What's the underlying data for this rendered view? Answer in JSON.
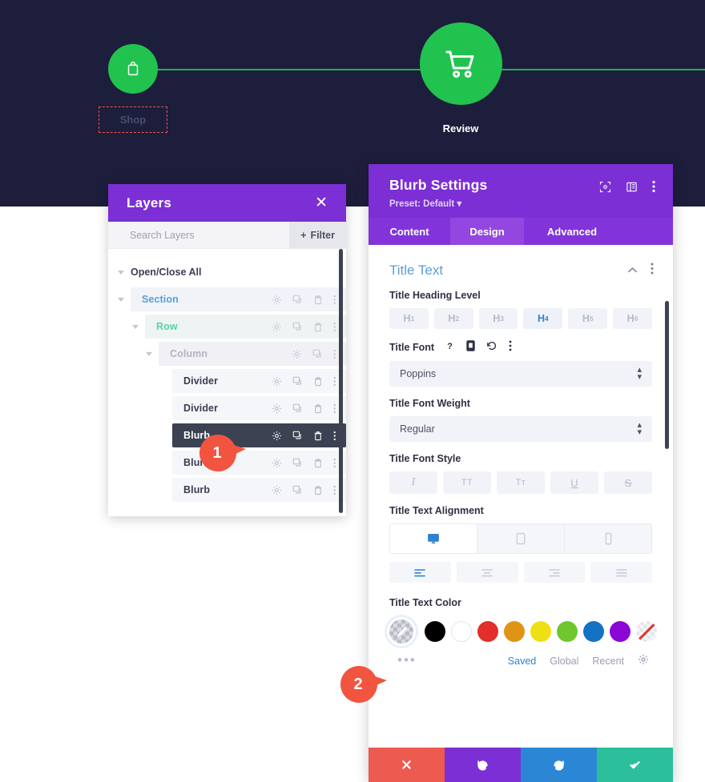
{
  "hero": {
    "steps": [
      {
        "name": "shop",
        "label": "Shop",
        "icon": "shopping-bag-icon"
      },
      {
        "name": "review",
        "label": "Review",
        "icon": "shopping-cart-icon"
      }
    ],
    "bg_color": "#1c1e3c",
    "accent_color": "#22c24f"
  },
  "layers": {
    "title": "Layers",
    "close_label": "✕",
    "search_placeholder": "Search Layers",
    "search_value": "",
    "filter_label": "Filter",
    "open_close_all": "Open/Close All",
    "rows": [
      {
        "label": "Section",
        "level": 1,
        "icons": [
          "gear-icon",
          "duplicate-icon",
          "trash-icon",
          "more-icon"
        ]
      },
      {
        "label": "Row",
        "level": 2,
        "icons": [
          "gear-icon",
          "duplicate-icon",
          "trash-icon",
          "more-icon"
        ]
      },
      {
        "label": "Column",
        "level": 3,
        "icons": [
          "gear-icon",
          "duplicate-icon",
          "more-icon"
        ]
      },
      {
        "label": "Divider",
        "level": 4,
        "icons": [
          "gear-icon",
          "duplicate-icon",
          "trash-icon",
          "more-icon"
        ]
      },
      {
        "label": "Divider",
        "level": 4,
        "icons": [
          "gear-icon",
          "duplicate-icon",
          "trash-icon",
          "more-icon"
        ]
      },
      {
        "label": "Blurb",
        "level": 4,
        "icons": [
          "gear-icon",
          "duplicate-icon",
          "trash-icon",
          "more-icon"
        ],
        "selected": true
      },
      {
        "label": "Blurb",
        "level": 4,
        "icons": [
          "gear-icon",
          "duplicate-icon",
          "trash-icon",
          "more-icon"
        ]
      },
      {
        "label": "Blurb",
        "level": 4,
        "icons": [
          "gear-icon",
          "duplicate-icon",
          "trash-icon",
          "more-icon"
        ]
      }
    ]
  },
  "markers": [
    {
      "number": "1"
    },
    {
      "number": "2"
    }
  ],
  "settings": {
    "title": "Blurb Settings",
    "preset": "Preset: Default ▾",
    "header_icons": [
      "fullscreen-icon",
      "layout-icon",
      "more-icon"
    ],
    "tabs": [
      {
        "label": "Content",
        "active": false
      },
      {
        "label": "Design",
        "active": true
      },
      {
        "label": "Advanced",
        "active": false
      }
    ],
    "section": {
      "title": "Title Text",
      "collapse_icon": "chevron-up-icon",
      "more_icon": "more-icon"
    },
    "heading_level": {
      "label": "Title Heading Level",
      "options": [
        "H1",
        "H2",
        "H3",
        "H4",
        "H5",
        "H6"
      ],
      "selected": "H4"
    },
    "font": {
      "label": "Title Font",
      "label_icons": [
        "help-icon",
        "responsive-icon",
        "reset-icon",
        "more-icon"
      ],
      "value": "Poppins"
    },
    "font_weight": {
      "label": "Title Font Weight",
      "value": "Regular"
    },
    "font_style": {
      "label": "Title Font Style",
      "options": [
        "I",
        "TT",
        "Tᴛ",
        "U",
        "S"
      ],
      "names": [
        "italic-icon",
        "uppercase-icon",
        "smallcaps-icon",
        "underline-icon",
        "strikethrough-icon"
      ]
    },
    "alignment": {
      "label": "Title Text Alignment",
      "devices": [
        {
          "name": "desktop-icon",
          "active": true
        },
        {
          "name": "tablet-icon",
          "active": false
        },
        {
          "name": "phone-icon",
          "active": false
        }
      ],
      "options": [
        {
          "name": "align-left-icon",
          "active": true
        },
        {
          "name": "align-center-icon",
          "active": false
        },
        {
          "name": "align-right-icon",
          "active": false
        },
        {
          "name": "align-justify-icon",
          "active": false
        }
      ]
    },
    "color": {
      "label": "Title Text Color",
      "eyedropper": "eyedropper-icon",
      "more_dots": "•••",
      "swatches": [
        "#000000",
        "#ffffff",
        "#e03029",
        "#e09416",
        "#efe014",
        "#6ec72d",
        "#1272c4",
        "#8b06d6",
        "none"
      ],
      "tabs": [
        {
          "label": "Saved",
          "active": true
        },
        {
          "label": "Global",
          "active": false
        },
        {
          "label": "Recent",
          "active": false
        }
      ],
      "gear_icon": "gear-icon"
    },
    "footer": [
      {
        "name": "cancel-button",
        "icon": "close-icon",
        "color": "#ed5a50"
      },
      {
        "name": "undo-button",
        "icon": "undo-icon",
        "color": "#7b2fd4"
      },
      {
        "name": "redo-button",
        "icon": "redo-icon",
        "color": "#2b87d6"
      },
      {
        "name": "save-button",
        "icon": "check-icon",
        "color": "#2cbf9b"
      }
    ]
  }
}
